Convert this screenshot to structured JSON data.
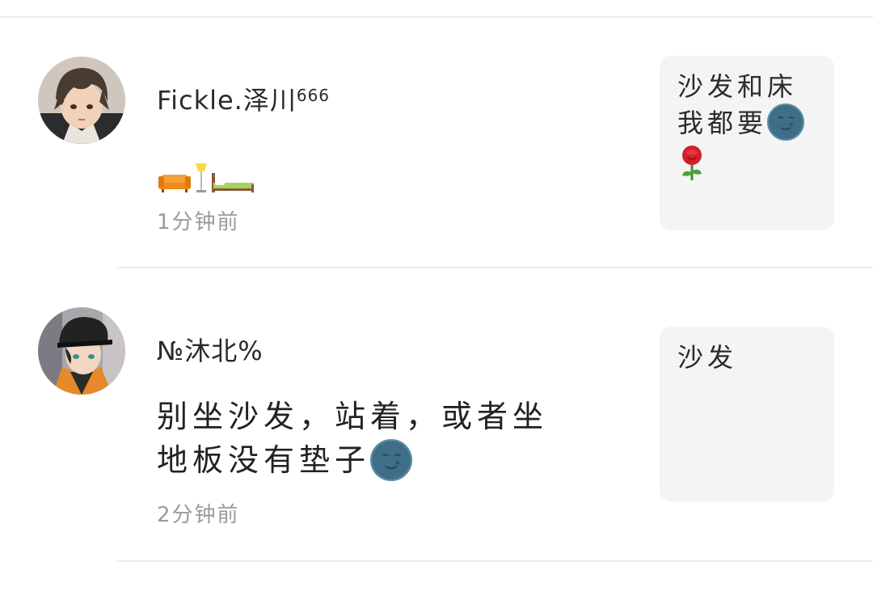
{
  "comments": [
    {
      "username": "Fickle.泽川",
      "username_suffix": "666",
      "text_emoji_names": [
        "couch-icon",
        "floor-lamp-icon",
        "bed-icon"
      ],
      "time": "1分钟前",
      "quote_text": "沙发和床我都要",
      "quote_emoji_names": [
        "new-moon-face-icon",
        "rose-icon"
      ]
    },
    {
      "username": "№沐北%",
      "text_line1": "别坐沙发，站着，或者坐",
      "text_line2": "地板没有垫子",
      "text_emoji_names": [
        "new-moon-face-icon"
      ],
      "time": "2分钟前",
      "quote_text": "沙发"
    }
  ],
  "colors": {
    "divider": "#ececec",
    "quote_bg": "#f4f4f4",
    "timestamp": "#9a9a9a",
    "text": "#222222"
  }
}
